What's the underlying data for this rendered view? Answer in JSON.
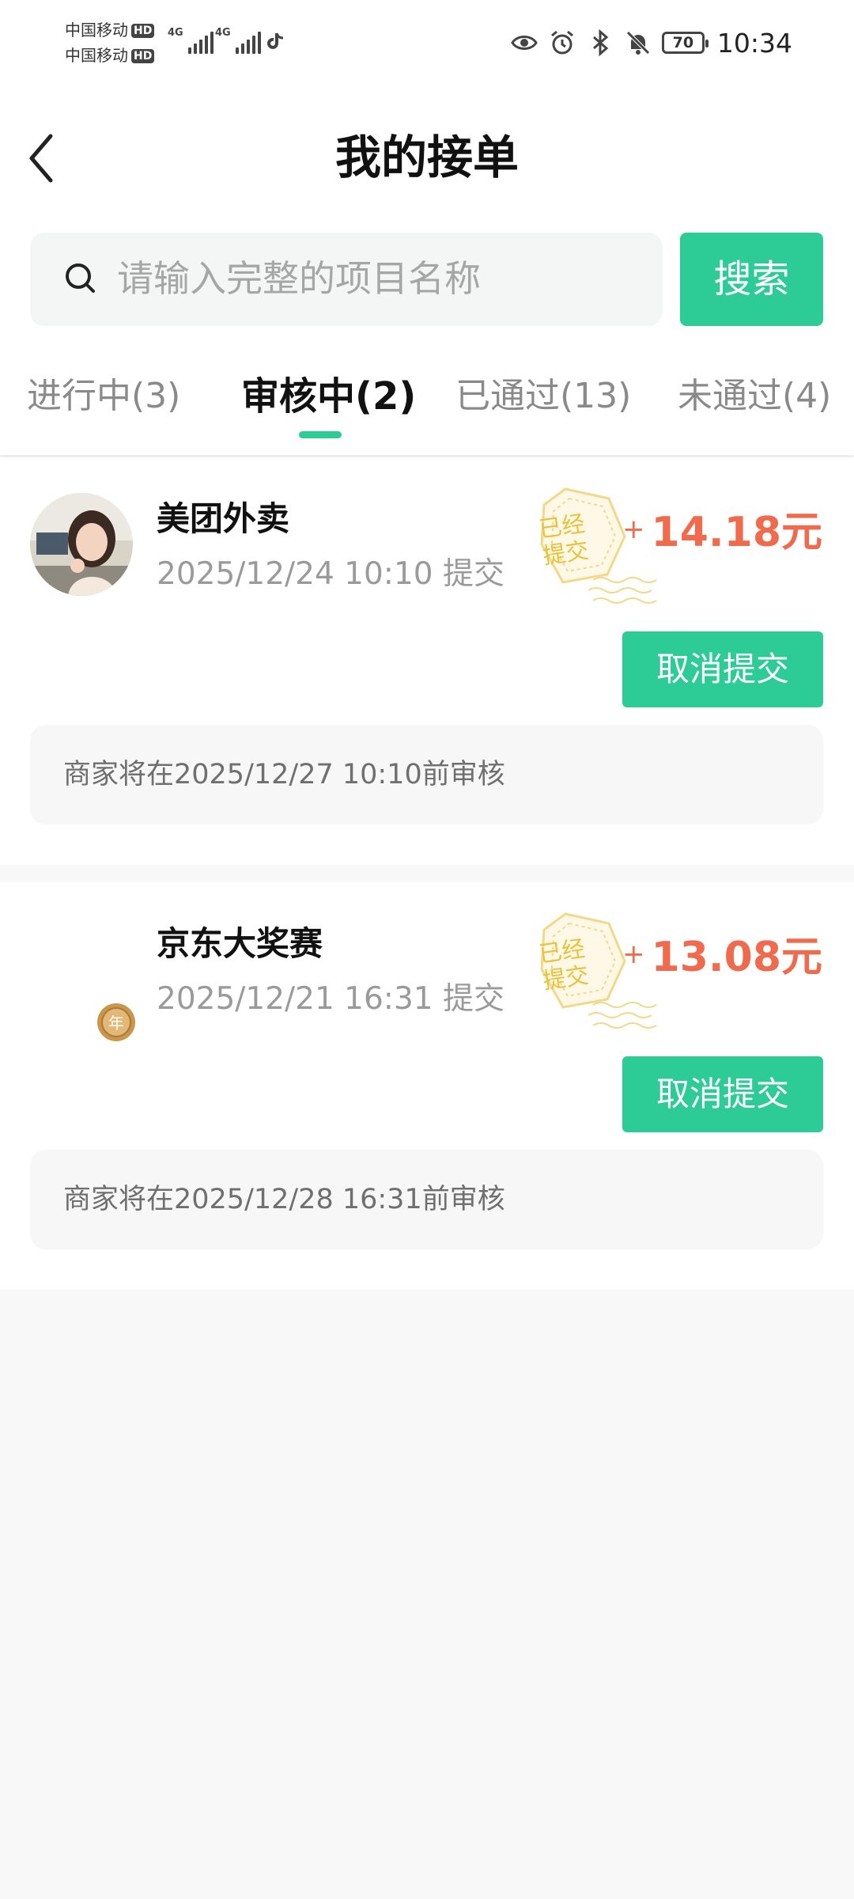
{
  "status_bar": {
    "carrier_1": "中国移动",
    "carrier_2": "中国移动",
    "hd_badge": "HD",
    "network_1": "4G",
    "network_2": "4G",
    "battery": "70",
    "time": "10:34"
  },
  "header": {
    "title": "我的接单"
  },
  "search": {
    "placeholder": "请输入完整的项目名称",
    "button_label": "搜索"
  },
  "tabs": [
    {
      "label": "进行中(3)",
      "active": false
    },
    {
      "label": "审核中(2)",
      "active": true
    },
    {
      "label": "已通过(13)",
      "active": false
    },
    {
      "label": "未通过(4)",
      "active": false
    }
  ],
  "orders": [
    {
      "name": "美团外卖",
      "submitted": "2025/12/24 10:10 提交",
      "stamp": "已经提交",
      "reward_plus": "+",
      "reward": "14.18元",
      "cancel_label": "取消提交",
      "notice": "商家将在2025/12/27 10:10前审核",
      "avatar_icon": "user-photo"
    },
    {
      "name": "京东大奖赛",
      "submitted": "2025/12/21 16:31 提交",
      "stamp": "已经提交",
      "reward_plus": "+",
      "reward": "13.08元",
      "cancel_label": "取消提交",
      "notice": "商家将在2025/12/28 16:31前审核",
      "medal_icon": "year-medal",
      "medal_text": "年"
    }
  ],
  "colors": {
    "accent": "#2dcb96",
    "reward": "#f06a4e",
    "stamp": "#e8c23a"
  }
}
